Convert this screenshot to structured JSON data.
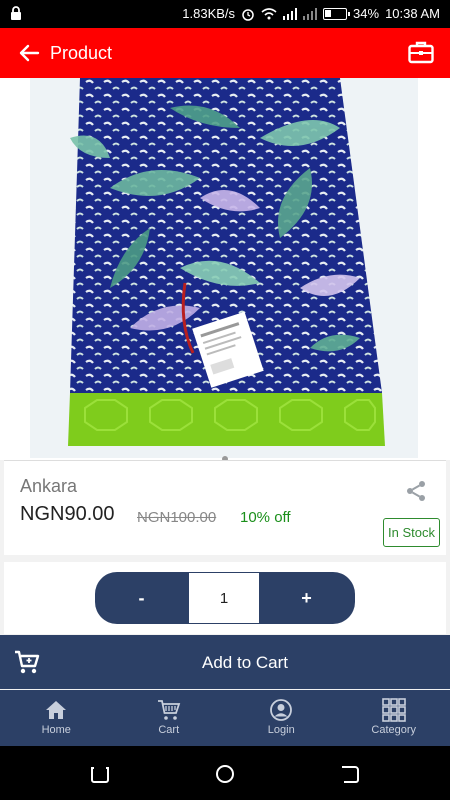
{
  "status_bar": {
    "speed": "1.83KB/s",
    "battery": "34%",
    "battery_level": 0.34,
    "time": "10:38 AM"
  },
  "app_bar": {
    "title": "Product"
  },
  "product": {
    "name": "Ankara",
    "price": "NGN90.00",
    "old_price": "NGN100.00",
    "discount": "10% off",
    "stock": "In Stock"
  },
  "quantity": {
    "minus": "-",
    "value": "1",
    "plus": "+"
  },
  "cart": {
    "label": "Add to Cart"
  },
  "nav": {
    "home": "Home",
    "cart": "Cart",
    "login": "Login",
    "category": "Category"
  },
  "colors": {
    "brand": "#ff0000",
    "navy": "#2c4066",
    "green": "#2e8b2e"
  }
}
